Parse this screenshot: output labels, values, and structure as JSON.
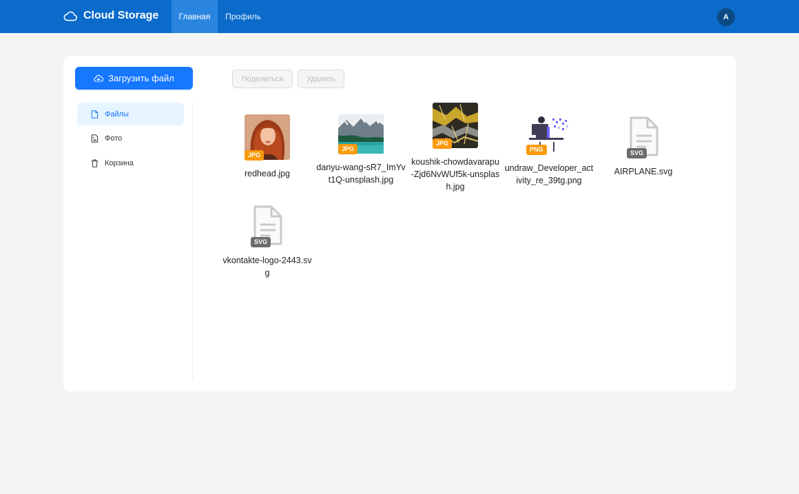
{
  "header": {
    "app_title": "Cloud Storage",
    "tabs": [
      {
        "label": "Главная",
        "active": true
      },
      {
        "label": "Профиль",
        "active": false
      }
    ],
    "avatar_initial": "A",
    "colors": {
      "header_bg": "#0a6bcb",
      "active_tab_bg": "#2a85e0",
      "avatar_bg": "#0c4a86"
    }
  },
  "sidebar": {
    "upload_label": "Загрузить файл",
    "items": [
      {
        "label": "Файлы",
        "icon": "file-icon",
        "selected": true
      },
      {
        "label": "Фото",
        "icon": "image-file-icon",
        "selected": false
      },
      {
        "label": "Корзина",
        "icon": "trash-icon",
        "selected": false
      }
    ]
  },
  "toolbar": {
    "share_label": "Поделиться",
    "delete_label": "Удалить"
  },
  "files": [
    {
      "name": "redhead.jpg",
      "type": "JPG"
    },
    {
      "name": "danyu-wang-sR7_ImYvt1Q-unsplash.jpg",
      "type": "JPG"
    },
    {
      "name": "koushik-chowdavarapu-Zjd6NvWUf5k-unsplash.jpg",
      "type": "JPG"
    },
    {
      "name": "undraw_Developer_activity_re_39tg.png",
      "type": "PNG"
    },
    {
      "name": "AIRPLANE.svg",
      "type": "SVG"
    },
    {
      "name": "vkontakte-logo-2443.svg",
      "type": "SVG"
    }
  ],
  "colors": {
    "accent": "#1677ff",
    "jpg_badge": "#fa9a0c",
    "svg_badge": "#6c6c6c",
    "page_bg": "#f4f4f4"
  }
}
